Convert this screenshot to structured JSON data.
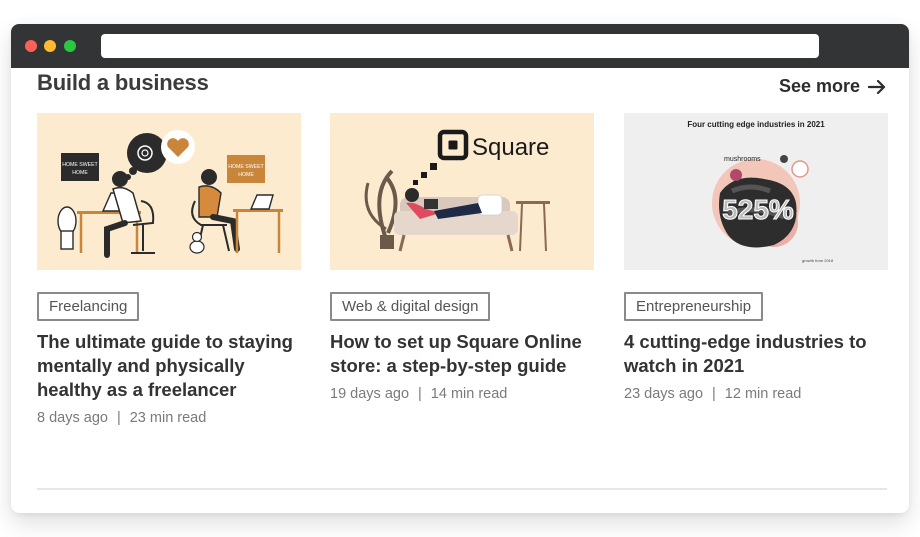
{
  "browser": {
    "url": ""
  },
  "section": {
    "title": "Build a business",
    "see_more_label": "See more"
  },
  "cards": [
    {
      "category": "Freelancing",
      "title": "The ultimate guide to staying mentally and physically healthy as a freelancer",
      "age": "8 days ago",
      "separator": "|",
      "read_time": "23 min read",
      "image": {
        "background": "#fdebd0",
        "sign_text": "HOME SWEET HOME"
      }
    },
    {
      "category": "Web & digital design",
      "title": "How to set up Square Online store: a step-by-step guide",
      "age": "19 days ago",
      "separator": "|",
      "read_time": "14 min read",
      "image": {
        "background": "#fdebd0",
        "logo_text": "Square"
      }
    },
    {
      "category": "Entrepreneurship",
      "title": "4 cutting-edge industries to watch in 2021",
      "age": "23 days ago",
      "separator": "|",
      "read_time": "12 min read",
      "image": {
        "background": "#efefef",
        "headline": "Four cutting edge industries in 2021",
        "label": "mushrooms",
        "stat": "525%",
        "caption": "growth from 2018"
      }
    }
  ],
  "colors": {
    "titlebar": "#333435",
    "heading": "#3b3b3b",
    "tag_border": "#8a8a8a",
    "meta": "#7a7a7a",
    "thumb_peach": "#fdebd0"
  }
}
